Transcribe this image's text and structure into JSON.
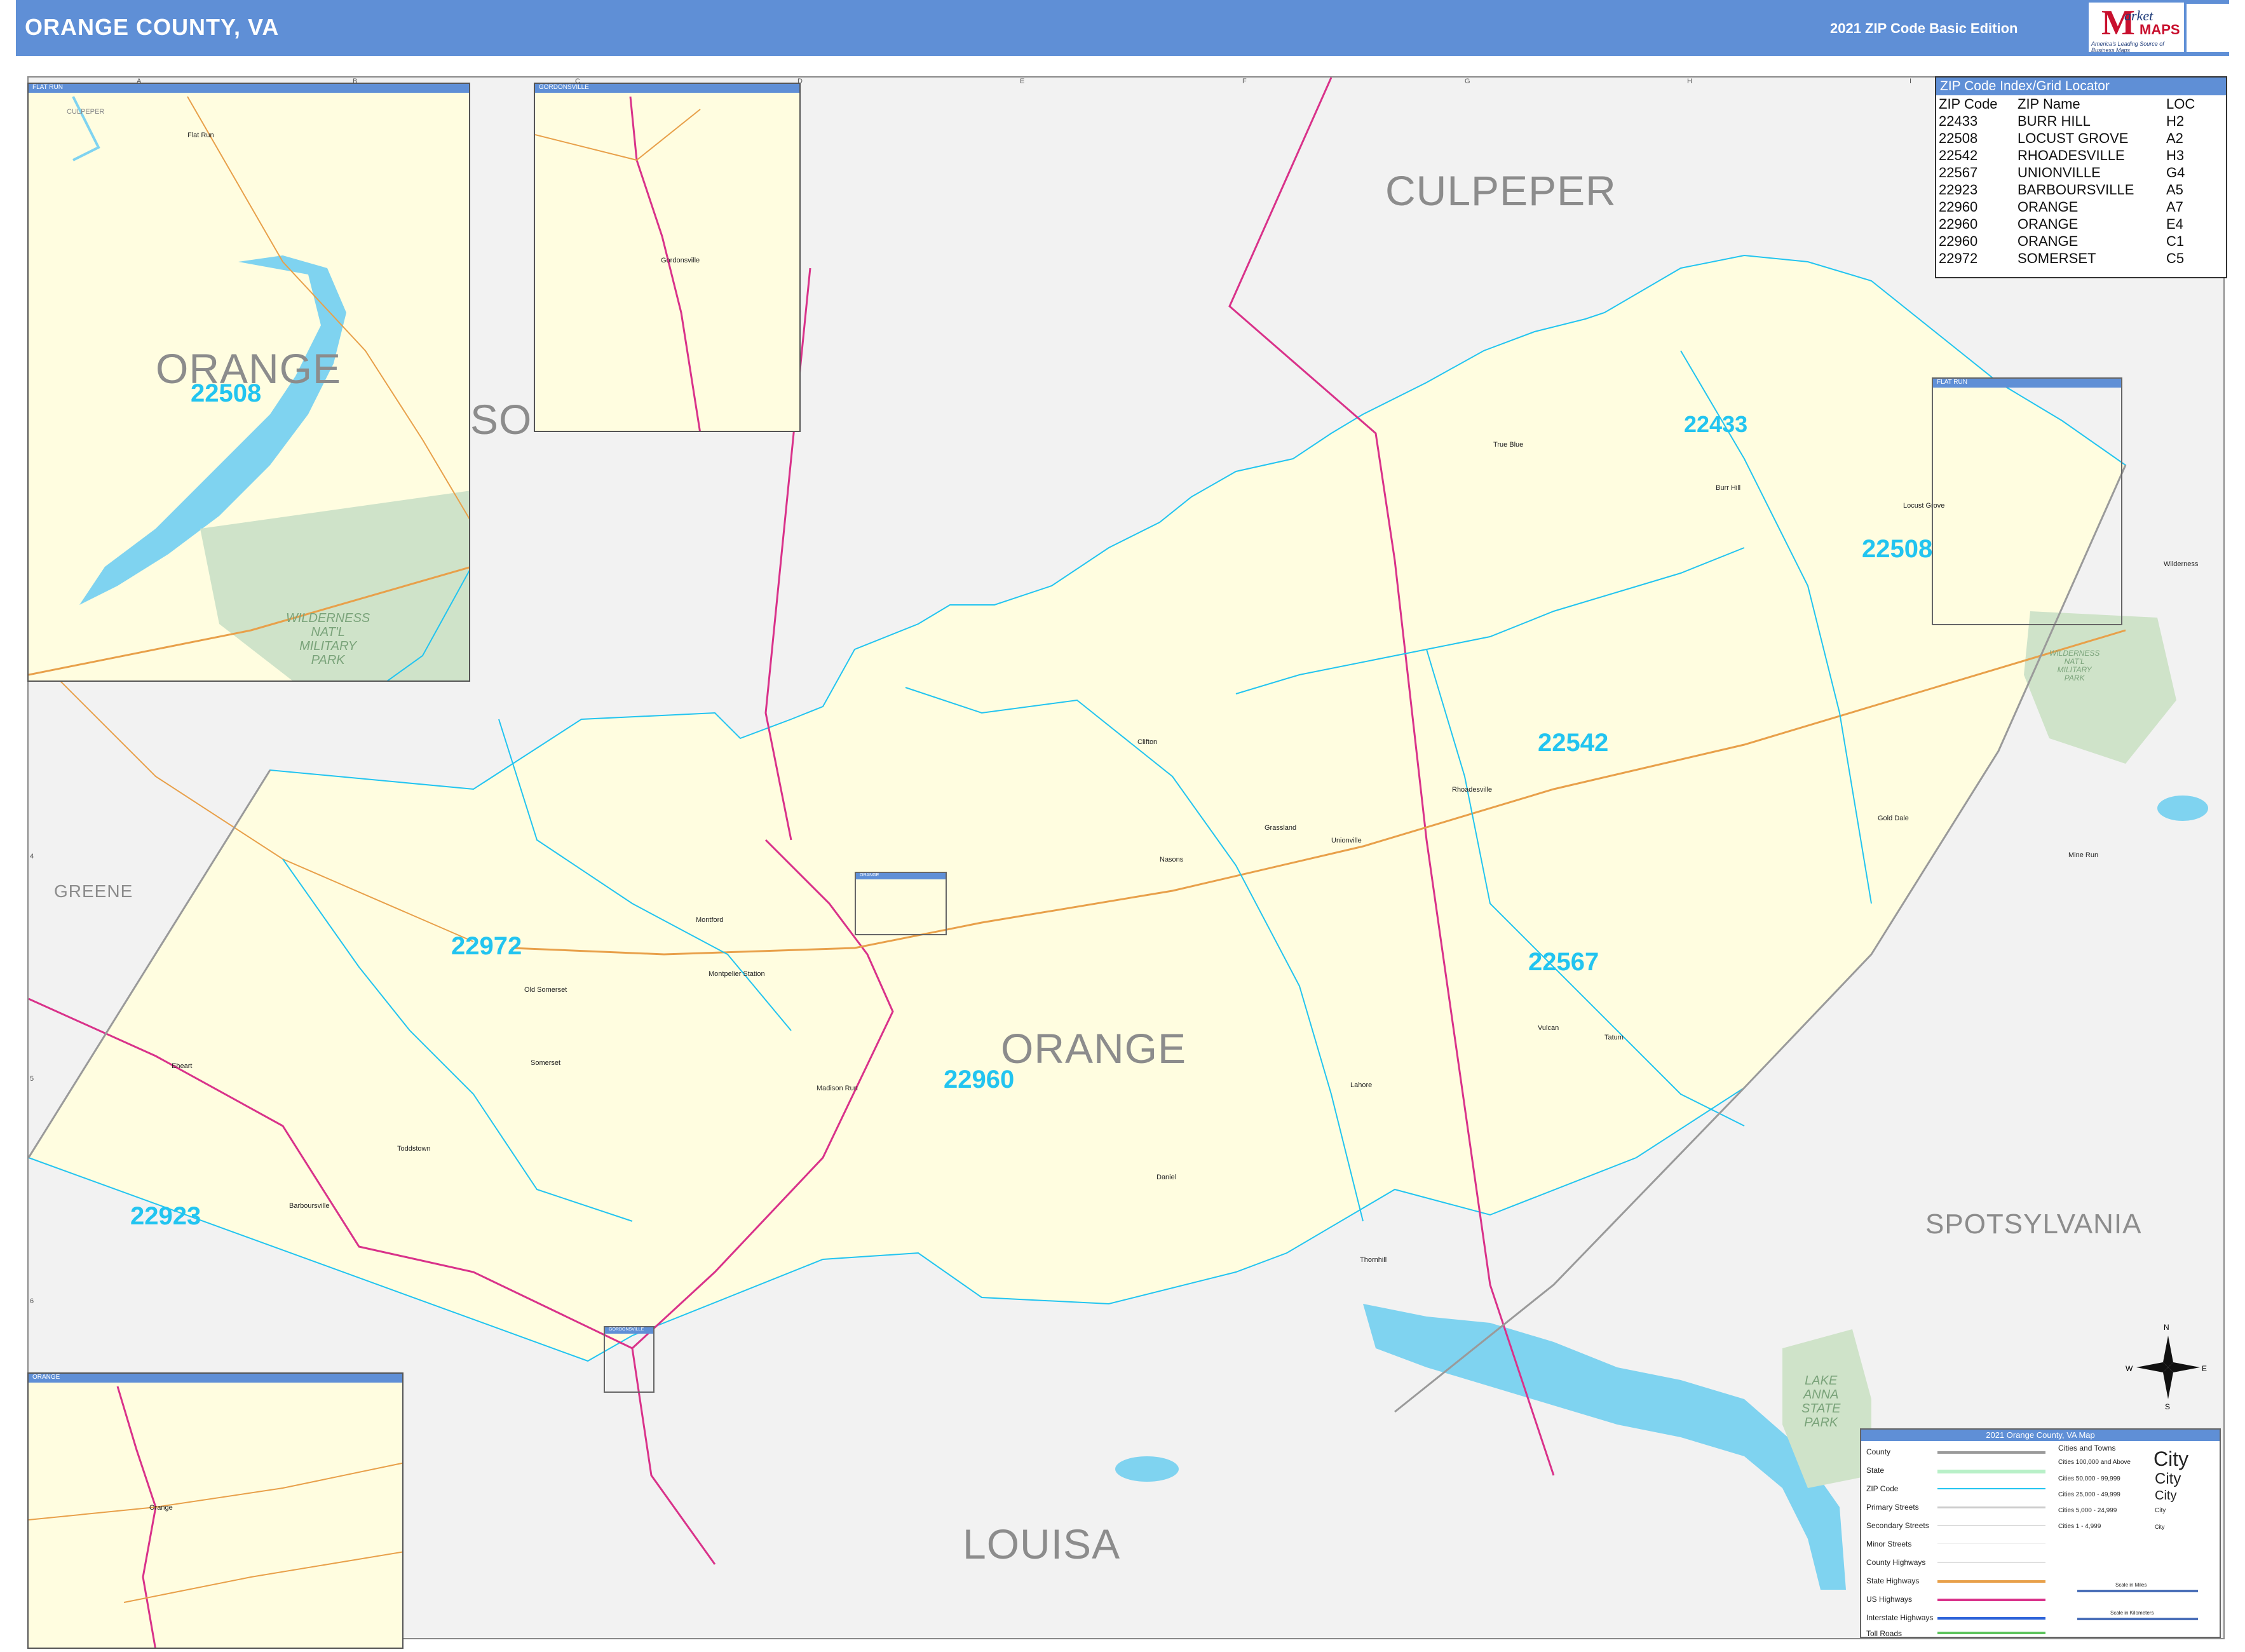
{
  "header": {
    "title": "ORANGE COUNTY, VA",
    "edition": "2021 ZIP Code Basic Edition",
    "logo": {
      "letter": "M",
      "market": "arket",
      "maps": "MAPS",
      "tagline": "America's Leading Source of Business Maps"
    }
  },
  "colors": {
    "header_bg": "#5f8fd6",
    "county_fill": "#fffde0",
    "outside_fill": "#f2f2f2",
    "zip_boundary": "#22c4f0",
    "us_highway": "#d9328a",
    "state_highway": "#e8a04a",
    "water": "#7fd3f0",
    "park": "#cfe3c9"
  },
  "grid": {
    "columns": [
      "A",
      "B",
      "C",
      "D",
      "E",
      "F",
      "G",
      "H",
      "I",
      "J"
    ],
    "rows": [
      "1",
      "2",
      "3",
      "4",
      "5",
      "6",
      "7"
    ]
  },
  "zip_index": {
    "title": "ZIP Code Index/Grid Locator",
    "columns": [
      "ZIP Code",
      "ZIP Name",
      "LOC"
    ],
    "rows": [
      [
        "22433",
        "BURR HILL",
        "H2"
      ],
      [
        "22508",
        "LOCUST GROVE",
        "A2"
      ],
      [
        "22542",
        "RHOADESVILLE",
        "H3"
      ],
      [
        "22567",
        "UNIONVILLE",
        "G4"
      ],
      [
        "22923",
        "BARBOURSVILLE",
        "A5"
      ],
      [
        "22960",
        "ORANGE",
        "A7"
      ],
      [
        "22960",
        "ORANGE",
        "E4"
      ],
      [
        "22960",
        "ORANGE",
        "C1"
      ],
      [
        "22972",
        "SOMERSET",
        "C5"
      ]
    ]
  },
  "counties": {
    "main": "ORANGE",
    "culpeper": "CULPEPER",
    "spotsylvania": "SPOTSYLVANIA",
    "louisa": "LOUISA",
    "greene": "GREENE",
    "so": "SO"
  },
  "zip_labels": {
    "z22433": "22433",
    "z22508": "22508",
    "z22542": "22542",
    "z22567": "22567",
    "z22960": "22960",
    "z22972": "22972",
    "z22923": "22923"
  },
  "towns": {
    "true_blue": "True Blue",
    "burr_hill": "Burr Hill",
    "locust_grove": "Locust Grove",
    "wilderness": "Wilderness",
    "clifton": "Clifton",
    "rhoadesville": "Rhoadesville",
    "grassland": "Grassland",
    "unionville": "Unionville",
    "gold_dale": "Gold Dale",
    "mine_run": "Mine Run",
    "nasons": "Nasons",
    "montford": "Montford",
    "montpelier_station": "Montpelier Station",
    "old_somerset": "Old Somerset",
    "somerset": "Somerset",
    "madison_run": "Madison Run",
    "vulcan": "Vulcan",
    "tatum": "Tatum",
    "lahore": "Lahore",
    "daniel": "Daniel",
    "thornhill": "Thornhill",
    "eheart": "Eheart",
    "toddstown": "Toddstown",
    "barboursville": "Barboursville",
    "gordonsville": "Gordonsville",
    "orange": "Orange",
    "flat_run": "Flat Run"
  },
  "parks": {
    "wilderness_inset": "WILDERNESS\nNAT'L\nMILITARY\nPARK",
    "wilderness_main": "WILDERNESS\nNAT'L\nMILITARY\nPARK",
    "lake_anna": "LAKE\nANNA\nSTATE\nPARK"
  },
  "insets": {
    "flat_run": {
      "title": "FLAT RUN",
      "county_label": "ORANGE",
      "zip": "22508",
      "culpeper": "CULPEPER"
    },
    "gordonsville": {
      "title": "GORDONSVILLE"
    },
    "orange": {
      "title": "ORANGE"
    },
    "flat_run_frame": "FLAT RUN",
    "orange_frame": "ORANGE",
    "gordonsville_frame": "GORDONSVILLE"
  },
  "legend": {
    "title": "2021 Orange County, VA Map",
    "items": [
      "County",
      "State",
      "ZIP Code",
      "Primary Streets",
      "Secondary Streets",
      "Minor Streets",
      "County Highways",
      "State Highways",
      "US Highways",
      "Interstate Highways",
      "Toll Roads"
    ],
    "cities_title": "Cities and Towns",
    "cities": [
      "Cities 100,000 and Above",
      "Cities 50,000 - 99,999",
      "Cities 25,000 - 49,999",
      "Cities 5,000 - 24,999",
      "Cities 1 - 4,999"
    ],
    "city_samples": [
      "City",
      "City",
      "City",
      "City",
      "City"
    ],
    "scale_miles": "Scale in Miles",
    "scale_km": "Scale in Kilometers"
  },
  "compass": {
    "n": "N",
    "s": "S",
    "e": "E",
    "w": "W"
  }
}
